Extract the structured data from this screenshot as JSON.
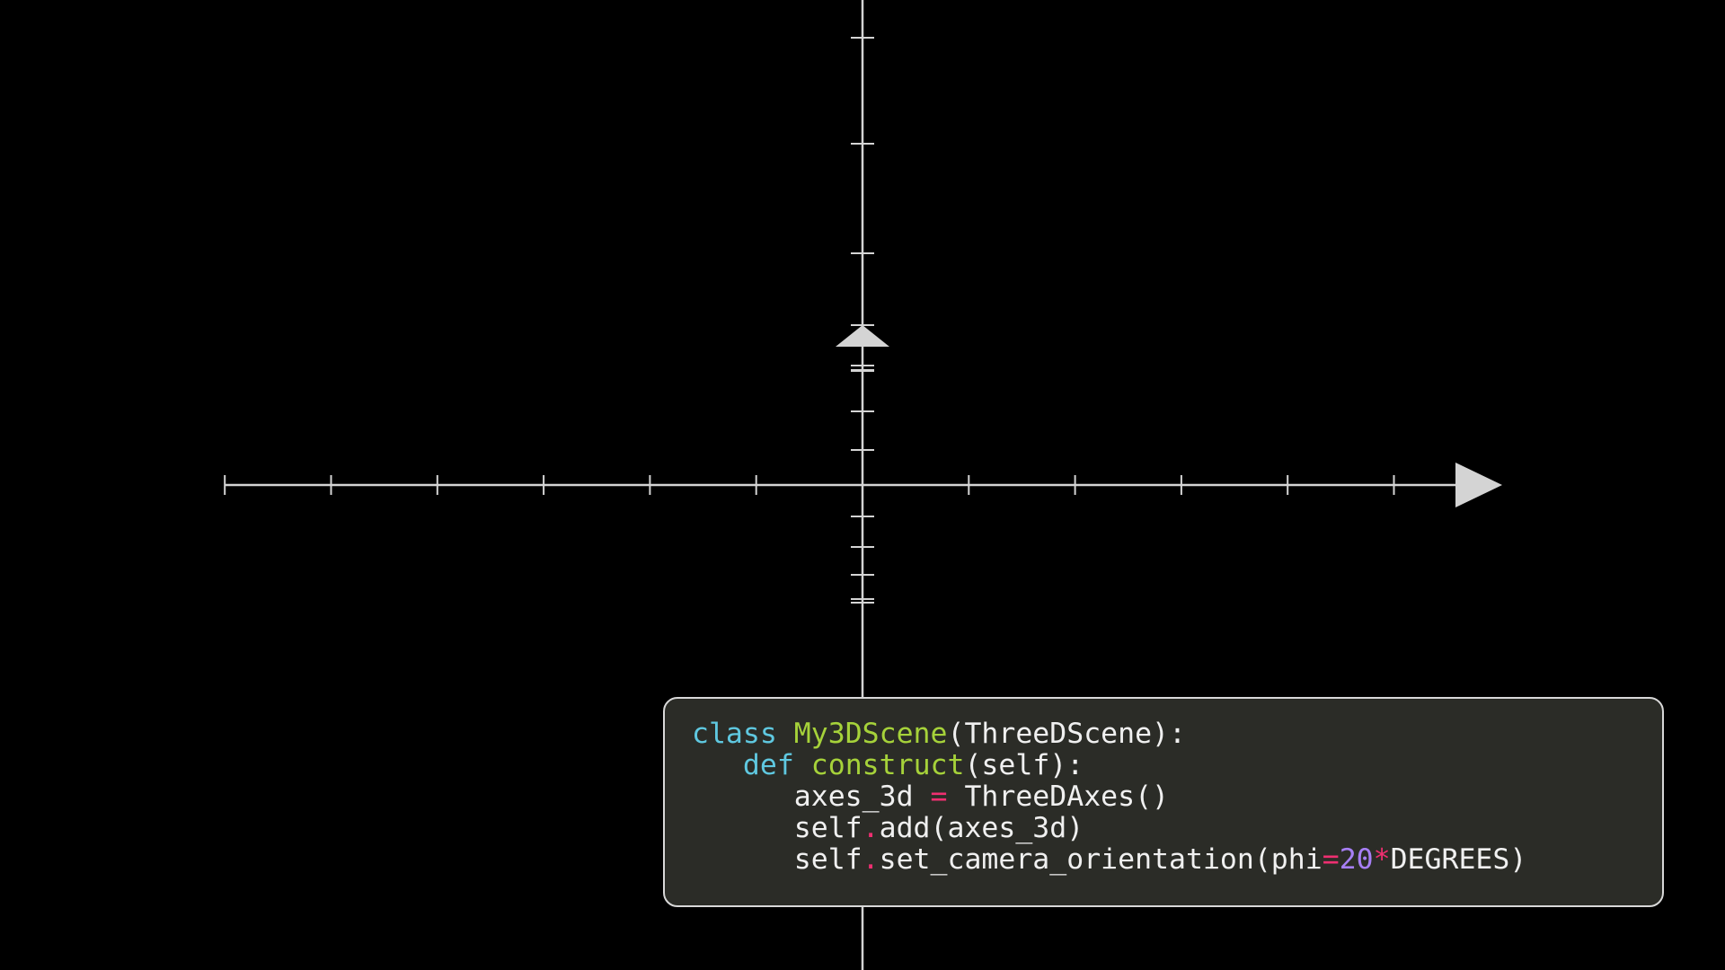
{
  "colors": {
    "background": "#000000",
    "axis": "#d4d4d4",
    "panel_background": "#2b2c27",
    "panel_border": "#d8d8d8",
    "keyword": "#5fc8e0",
    "function_name": "#a6d23a",
    "operator": "#ef2f71",
    "number": "#a77ff5",
    "text": "#f0f0f0"
  },
  "axes": {
    "x_axis": {
      "range": [
        -6,
        6
      ],
      "ticks": [
        -6,
        -5,
        -4,
        -3,
        -2,
        -1,
        1,
        2,
        3,
        4,
        5
      ],
      "arrow": "right"
    },
    "y_axis": {
      "range": [
        -4,
        4
      ],
      "ticks": [
        -4,
        -3,
        -2,
        -1,
        1,
        2,
        3,
        4
      ]
    },
    "z_axis": {
      "arrow": "up"
    },
    "camera_phi_degrees": 20
  },
  "code": {
    "lines": [
      [
        {
          "text": "class",
          "style": "kw"
        },
        {
          "text": " ",
          "style": "txt"
        },
        {
          "text": "My3DScene",
          "style": "fn"
        },
        {
          "text": "(ThreeDScene):",
          "style": "txt"
        }
      ],
      [
        {
          "text": "   ",
          "style": "txt"
        },
        {
          "text": "def",
          "style": "kw"
        },
        {
          "text": " ",
          "style": "txt"
        },
        {
          "text": "construct",
          "style": "fn"
        },
        {
          "text": "(self):",
          "style": "txt"
        }
      ],
      [
        {
          "text": "      axes_3d ",
          "style": "txt"
        },
        {
          "text": "=",
          "style": "op"
        },
        {
          "text": " ThreeDAxes()",
          "style": "txt"
        }
      ],
      [
        {
          "text": "      self",
          "style": "txt"
        },
        {
          "text": ".",
          "style": "op"
        },
        {
          "text": "add(axes_3d)",
          "style": "txt"
        }
      ],
      [
        {
          "text": "      self",
          "style": "txt"
        },
        {
          "text": ".",
          "style": "op"
        },
        {
          "text": "set_camera_orientation(phi",
          "style": "txt"
        },
        {
          "text": "=",
          "style": "op"
        },
        {
          "text": "20",
          "style": "num"
        },
        {
          "text": "*",
          "style": "op"
        },
        {
          "text": "DEGREES)",
          "style": "txt"
        }
      ]
    ]
  }
}
